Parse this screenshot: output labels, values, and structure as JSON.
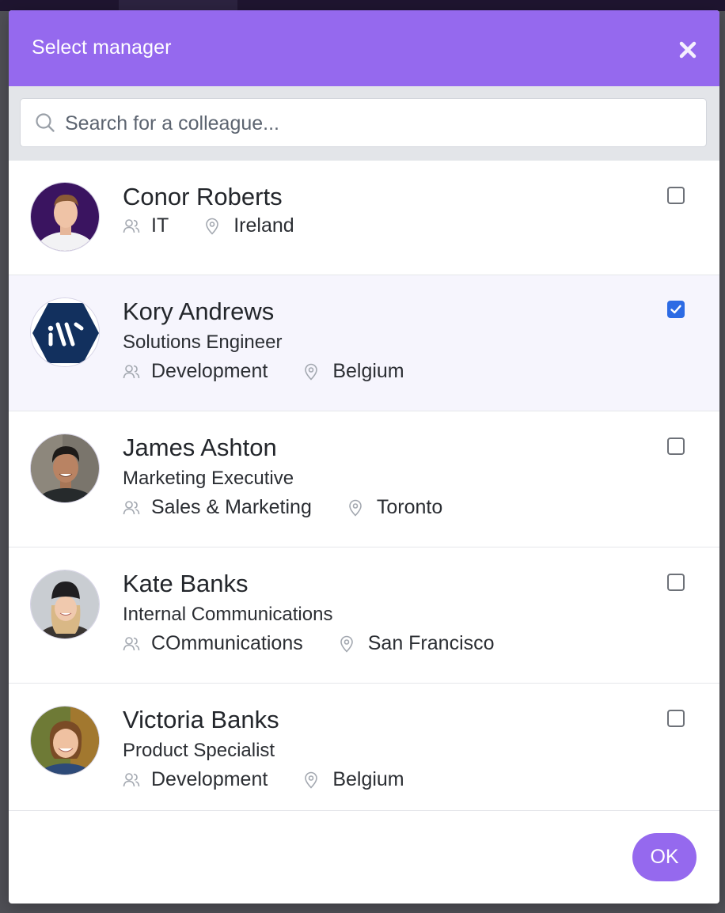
{
  "modal": {
    "title": "Select manager",
    "close_icon": "close-icon"
  },
  "search": {
    "placeholder": "Search for a colleague...",
    "value": "",
    "icon": "search-icon"
  },
  "people": [
    {
      "name": "Conor Roberts",
      "role": "",
      "department": "IT",
      "location": "Ireland",
      "checked": false,
      "avatar": "photo-man-purple-bg"
    },
    {
      "name": "Kory Andrews",
      "role": "Solutions Engineer",
      "department": "Development",
      "location": "Belgium",
      "checked": true,
      "avatar": "hexagon-logo"
    },
    {
      "name": "James Ashton",
      "role": "Marketing Executive",
      "department": "Sales & Marketing",
      "location": "Toronto",
      "checked": false,
      "avatar": "photo-man-smiling"
    },
    {
      "name": "Kate Banks",
      "role": "Internal Communications",
      "department": "COmmunications",
      "location": "San Francisco",
      "checked": false,
      "avatar": "photo-woman-beanie"
    },
    {
      "name": "Victoria Banks",
      "role": "Product Specialist",
      "department": "Development",
      "location": "Belgium",
      "checked": false,
      "avatar": "photo-woman-smiling"
    }
  ],
  "footer": {
    "ok_label": "OK"
  },
  "colors": {
    "accent": "#9569ee",
    "checkbox_checked": "#2d6be4",
    "selected_row": "#f6f5fd",
    "search_band": "#e3e5e9"
  }
}
